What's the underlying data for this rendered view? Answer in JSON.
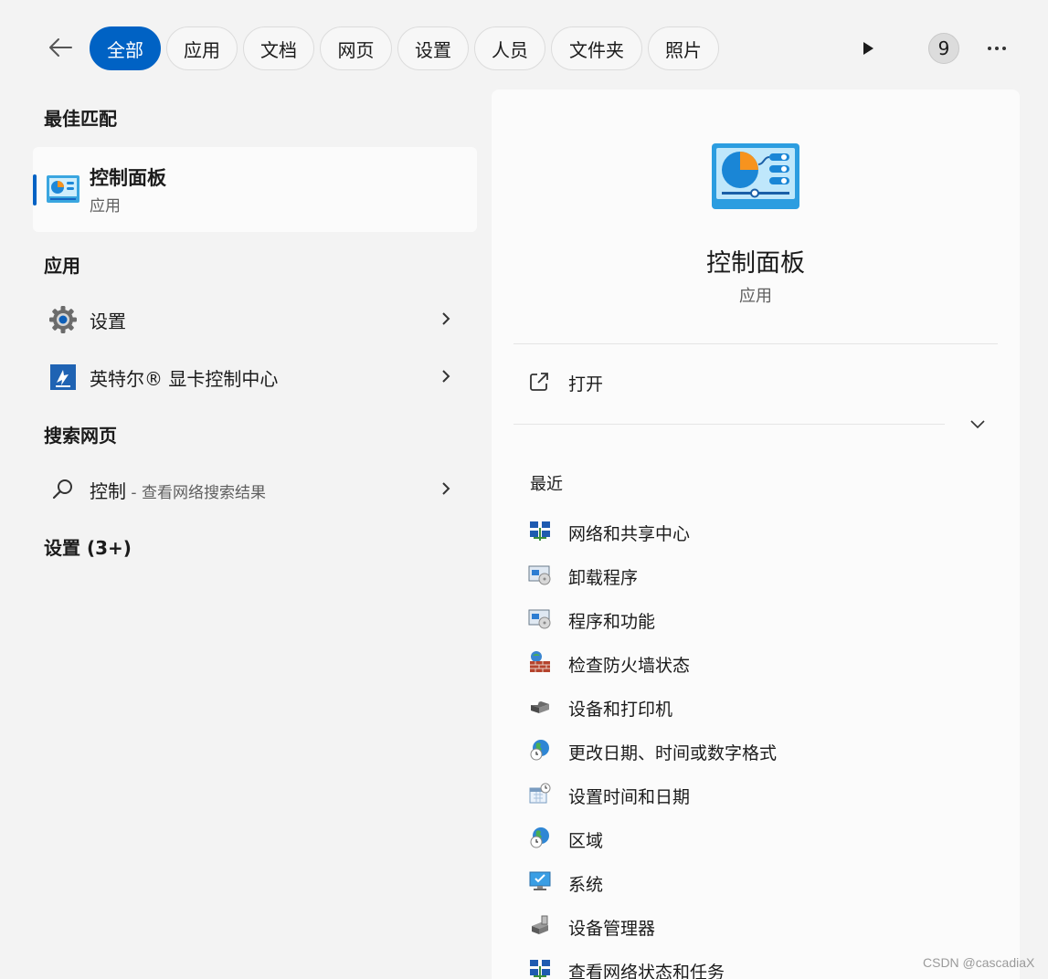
{
  "filter_bar": {
    "back_icon": "back-arrow-icon",
    "tabs": [
      {
        "label": "全部",
        "active": true
      },
      {
        "label": "应用",
        "active": false
      },
      {
        "label": "文档",
        "active": false
      },
      {
        "label": "网页",
        "active": false
      },
      {
        "label": "设置",
        "active": false
      },
      {
        "label": "人员",
        "active": false
      },
      {
        "label": "文件夹",
        "active": false
      },
      {
        "label": "照片",
        "active": false
      }
    ],
    "play_icon": "play-icon",
    "count": "9",
    "more_icon": "more-icon"
  },
  "best_match": {
    "heading": "最佳匹配",
    "title": "控制面板",
    "subtitle": "应用",
    "icon": "control-panel-icon"
  },
  "apps": {
    "heading": "应用",
    "items": [
      {
        "label": "设置",
        "icon": "gear-icon"
      },
      {
        "label": "英特尔® 显卡控制中心",
        "icon": "intel-graphics-icon"
      }
    ]
  },
  "web_search": {
    "heading": "搜索网页",
    "query": "控制",
    "suffix": " - 查看网络搜索结果",
    "icon": "search-icon"
  },
  "settings_section": {
    "heading": "设置 (3+)"
  },
  "preview": {
    "title": "控制面板",
    "subtitle": "应用",
    "open_label": "打开",
    "recent_heading": "最近",
    "recent": [
      {
        "label": "网络和共享中心",
        "icon": "network-icon"
      },
      {
        "label": "卸载程序",
        "icon": "programs-icon"
      },
      {
        "label": "程序和功能",
        "icon": "programs-icon"
      },
      {
        "label": "检查防火墙状态",
        "icon": "firewall-icon"
      },
      {
        "label": "设备和打印机",
        "icon": "printer-icon"
      },
      {
        "label": "更改日期、时间或数字格式",
        "icon": "globe-clock-icon"
      },
      {
        "label": "设置时间和日期",
        "icon": "calendar-clock-icon"
      },
      {
        "label": "区域",
        "icon": "globe-clock-icon"
      },
      {
        "label": "系统",
        "icon": "system-monitor-icon"
      },
      {
        "label": "设备管理器",
        "icon": "device-manager-icon"
      },
      {
        "label": "查看网络状态和任务",
        "icon": "network-icon"
      }
    ]
  },
  "watermark": "CSDN @cascadiaX",
  "colors": {
    "accent": "#0062c4",
    "background": "#f3f3f3",
    "panel": "#fbfbfb"
  }
}
